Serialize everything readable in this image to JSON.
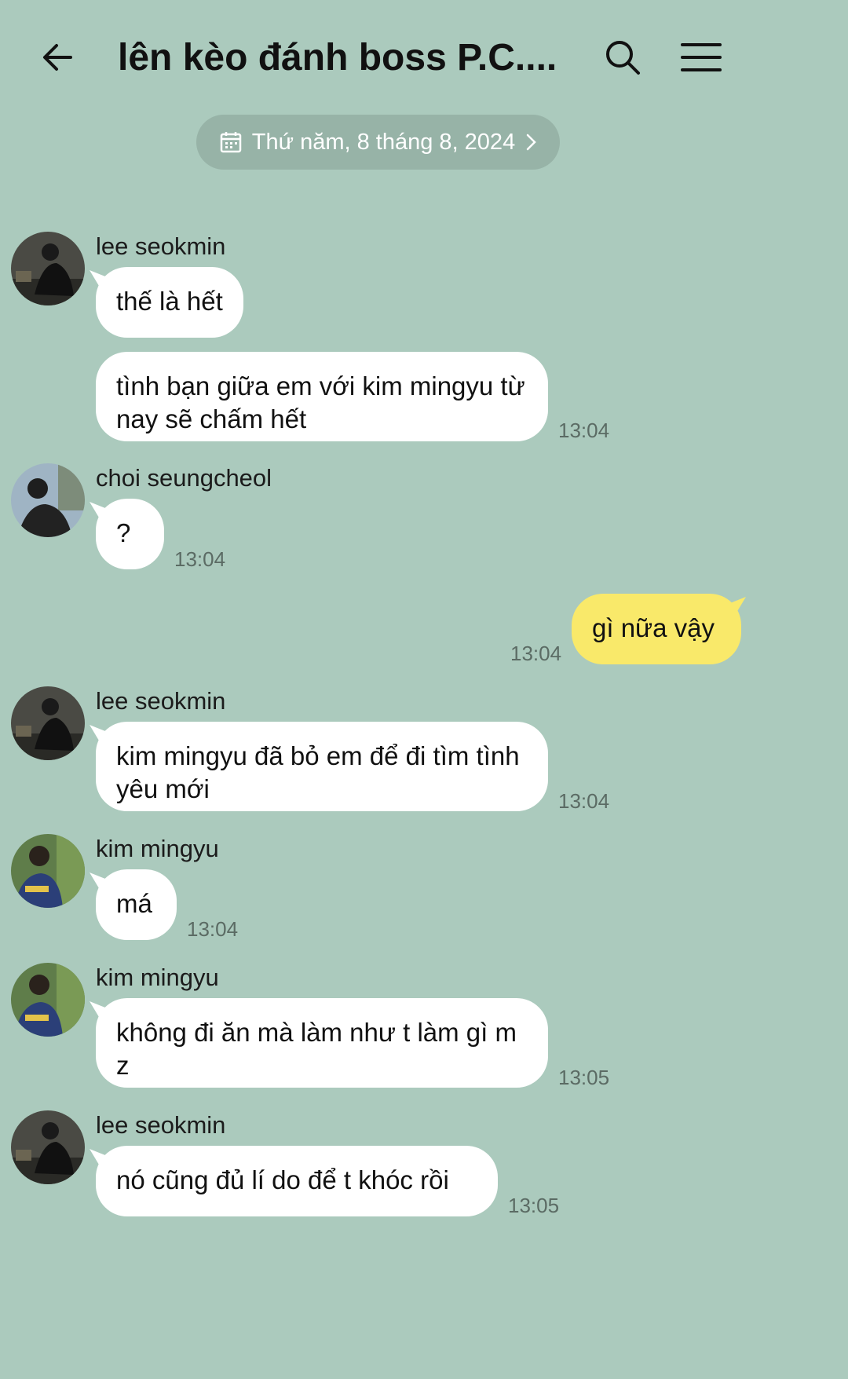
{
  "header": {
    "title": "lên kèo đánh boss P.C....",
    "back_icon": "arrow-left-icon",
    "search_icon": "search-icon",
    "menu_icon": "hamburger-menu-icon"
  },
  "date_divider": {
    "label": "Thứ năm, 8 tháng 8, 2024",
    "icon": "calendar-icon"
  },
  "colors": {
    "background": "#abcabd",
    "incoming_bubble": "#ffffff",
    "outgoing_bubble": "#f9e96a"
  },
  "messages": [
    {
      "sender": "lee seokmin",
      "text": "thế là hết",
      "time": ""
    },
    {
      "sender": "",
      "text": "tình bạn giữa em với kim mingyu từ nay sẽ chấm hết",
      "time": "13:04"
    },
    {
      "sender": "choi seungcheol",
      "text": "?",
      "time": "13:04"
    },
    {
      "sender": "",
      "text": "gì nữa vậy",
      "time": "13:04"
    },
    {
      "sender": "lee seokmin",
      "text": "kim mingyu đã bỏ em để đi tìm tình yêu mới",
      "time": "13:04"
    },
    {
      "sender": "kim mingyu",
      "text": "má",
      "time": "13:04"
    },
    {
      "sender": "kim mingyu",
      "text": "không đi ăn mà làm như t làm gì m z",
      "time": "13:05"
    },
    {
      "sender": "lee seokmin",
      "text": "nó cũng đủ lí do để t khóc rồi",
      "time": "13:05"
    }
  ]
}
